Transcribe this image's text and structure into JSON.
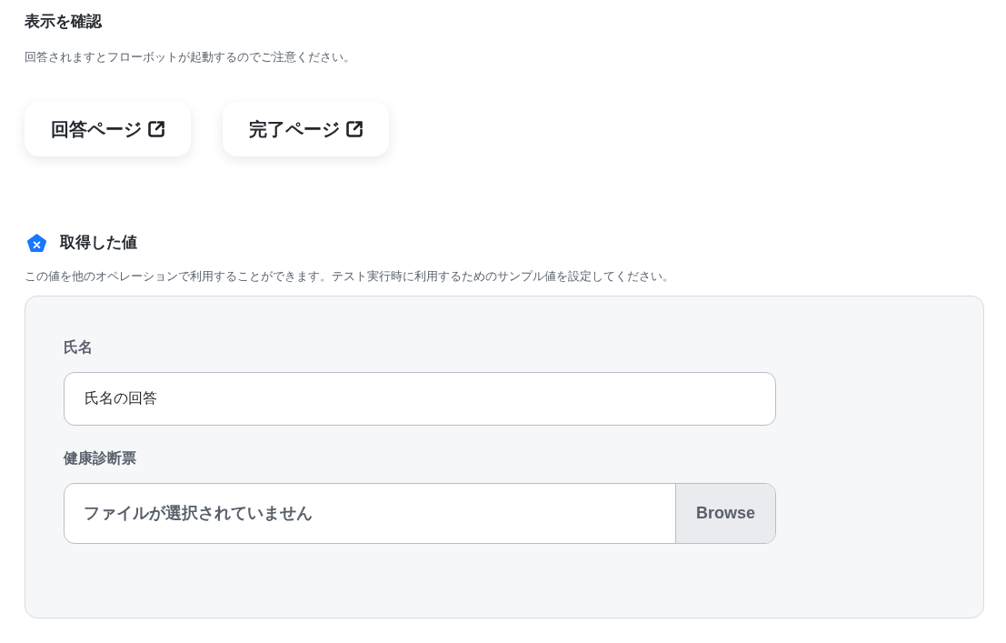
{
  "confirm_section": {
    "title": "表示を確認",
    "note": "回答されますとフローボットが起動するのでご注意ください。",
    "buttons": [
      {
        "label": "回答ページ"
      },
      {
        "label": "完了ページ"
      }
    ]
  },
  "values_section": {
    "title": "取得した値",
    "description": "この値を他のオペレーションで利用することができます。テスト実行時に利用するためのサンプル値を設定してください。",
    "fields": [
      {
        "kind": "text",
        "label": "氏名",
        "value": "氏名の回答"
      },
      {
        "kind": "file",
        "label": "健康診断票",
        "file_status": "ファイルが選択されていません",
        "button": "Browse"
      }
    ]
  }
}
